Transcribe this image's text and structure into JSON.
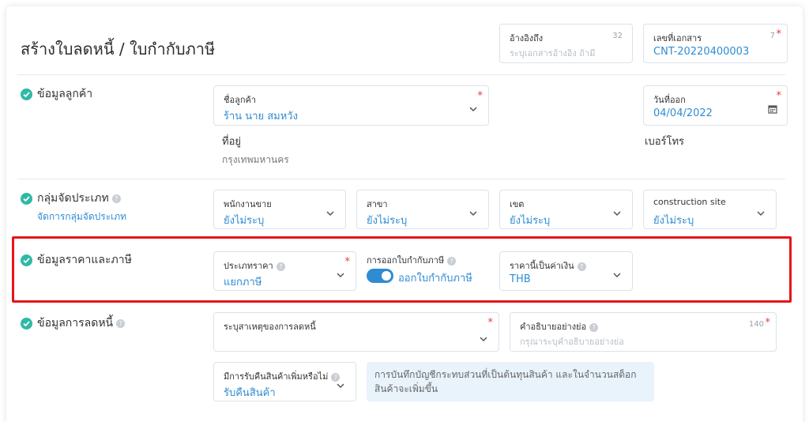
{
  "header": {
    "title": "สร้างใบลดหนี้ / ใบกำกับภาษี",
    "reference": {
      "label": "อ้างอิงถึง",
      "counter": "32",
      "placeholder": "ระบุเอกสารอ้างอิง ถ้ามี"
    },
    "doc_number": {
      "label": "เลขที่เอกสาร",
      "counter": "7",
      "required": "*",
      "value": "CNT-20220400003"
    }
  },
  "customer": {
    "title": "ข้อมูลลูกค้า",
    "name": {
      "label": "ชื่อลูกค้า",
      "required": "*",
      "value": "ร้าน นาย สมหวัง"
    },
    "issue_date": {
      "label": "วันที่ออก",
      "required": "*",
      "value": "04/04/2022"
    },
    "address_label": "ที่อยู่",
    "address_value": "กรุงเทพมหานคร",
    "phone_label": "เบอร์โทร"
  },
  "group": {
    "title": "กลุ่มจัดประเภท",
    "manage_link": "จัดการกลุ่มจัดประเภท",
    "fields": [
      {
        "label": "พนักงานขาย",
        "value": "ยังไม่ระบุ"
      },
      {
        "label": "สาขา",
        "value": "ยังไม่ระบุ"
      },
      {
        "label": "เขต",
        "value": "ยังไม่ระบุ"
      },
      {
        "label": "construction site",
        "value": "ยังไม่ระบุ"
      }
    ]
  },
  "pricing": {
    "title": "ข้อมูลราคาและภาษี",
    "price_type": {
      "label": "ประเภทราคา",
      "required": "*",
      "value": "แยกภาษี"
    },
    "tax_invoice": {
      "label": "การออกใบกำกับภาษี",
      "toggle_label": "ออกใบกำกับภาษี",
      "on": true
    },
    "currency": {
      "label": "ราคานี้เป็นค่าเงิน",
      "value": "THB"
    }
  },
  "credit": {
    "title": "ข้อมูลการลดหนี้",
    "reason": {
      "label": "ระบุสาเหตุของการลดหนี้",
      "required": "*"
    },
    "description": {
      "label": "คำอธิบายอย่างย่อ",
      "counter": "140",
      "required": "*",
      "placeholder": "กรุณาระบุคำอธิบายอย่างย่อ"
    },
    "return_goods": {
      "label": "มีการรับคืนสินค้าเพิ่มหรือไม่",
      "value": "รับคืนสินค้า"
    },
    "info": "การบันทึกบัญชีกระทบส่วนที่เป็นต้นทุนสินค้า และในจำนวนสต็อกสินค้าจะเพิ่มขึ้น"
  },
  "colors": {
    "accent": "#2f8cd3",
    "check": "#2fb9a6",
    "highlight": "#e8141a",
    "required": "#e53b3b"
  }
}
